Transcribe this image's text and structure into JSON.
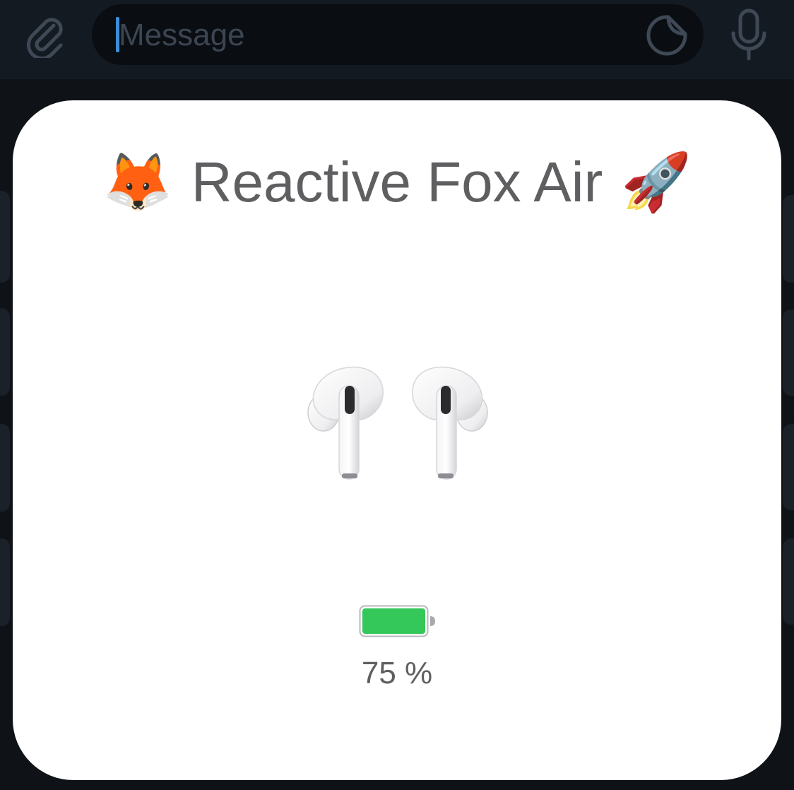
{
  "composer": {
    "placeholder": "Message",
    "value": "",
    "icons": {
      "attach": "paperclip-icon",
      "sticker": "sticker-icon",
      "mic": "microphone-icon"
    },
    "accent": "#3b8fd8"
  },
  "popup": {
    "title": "Reactive Fox Air",
    "title_emoji_left": "🦊",
    "title_emoji_right": "🚀",
    "device_image": "earbuds-image",
    "battery": {
      "level": 0.75,
      "label": "75 %",
      "color": "#34c759"
    }
  }
}
